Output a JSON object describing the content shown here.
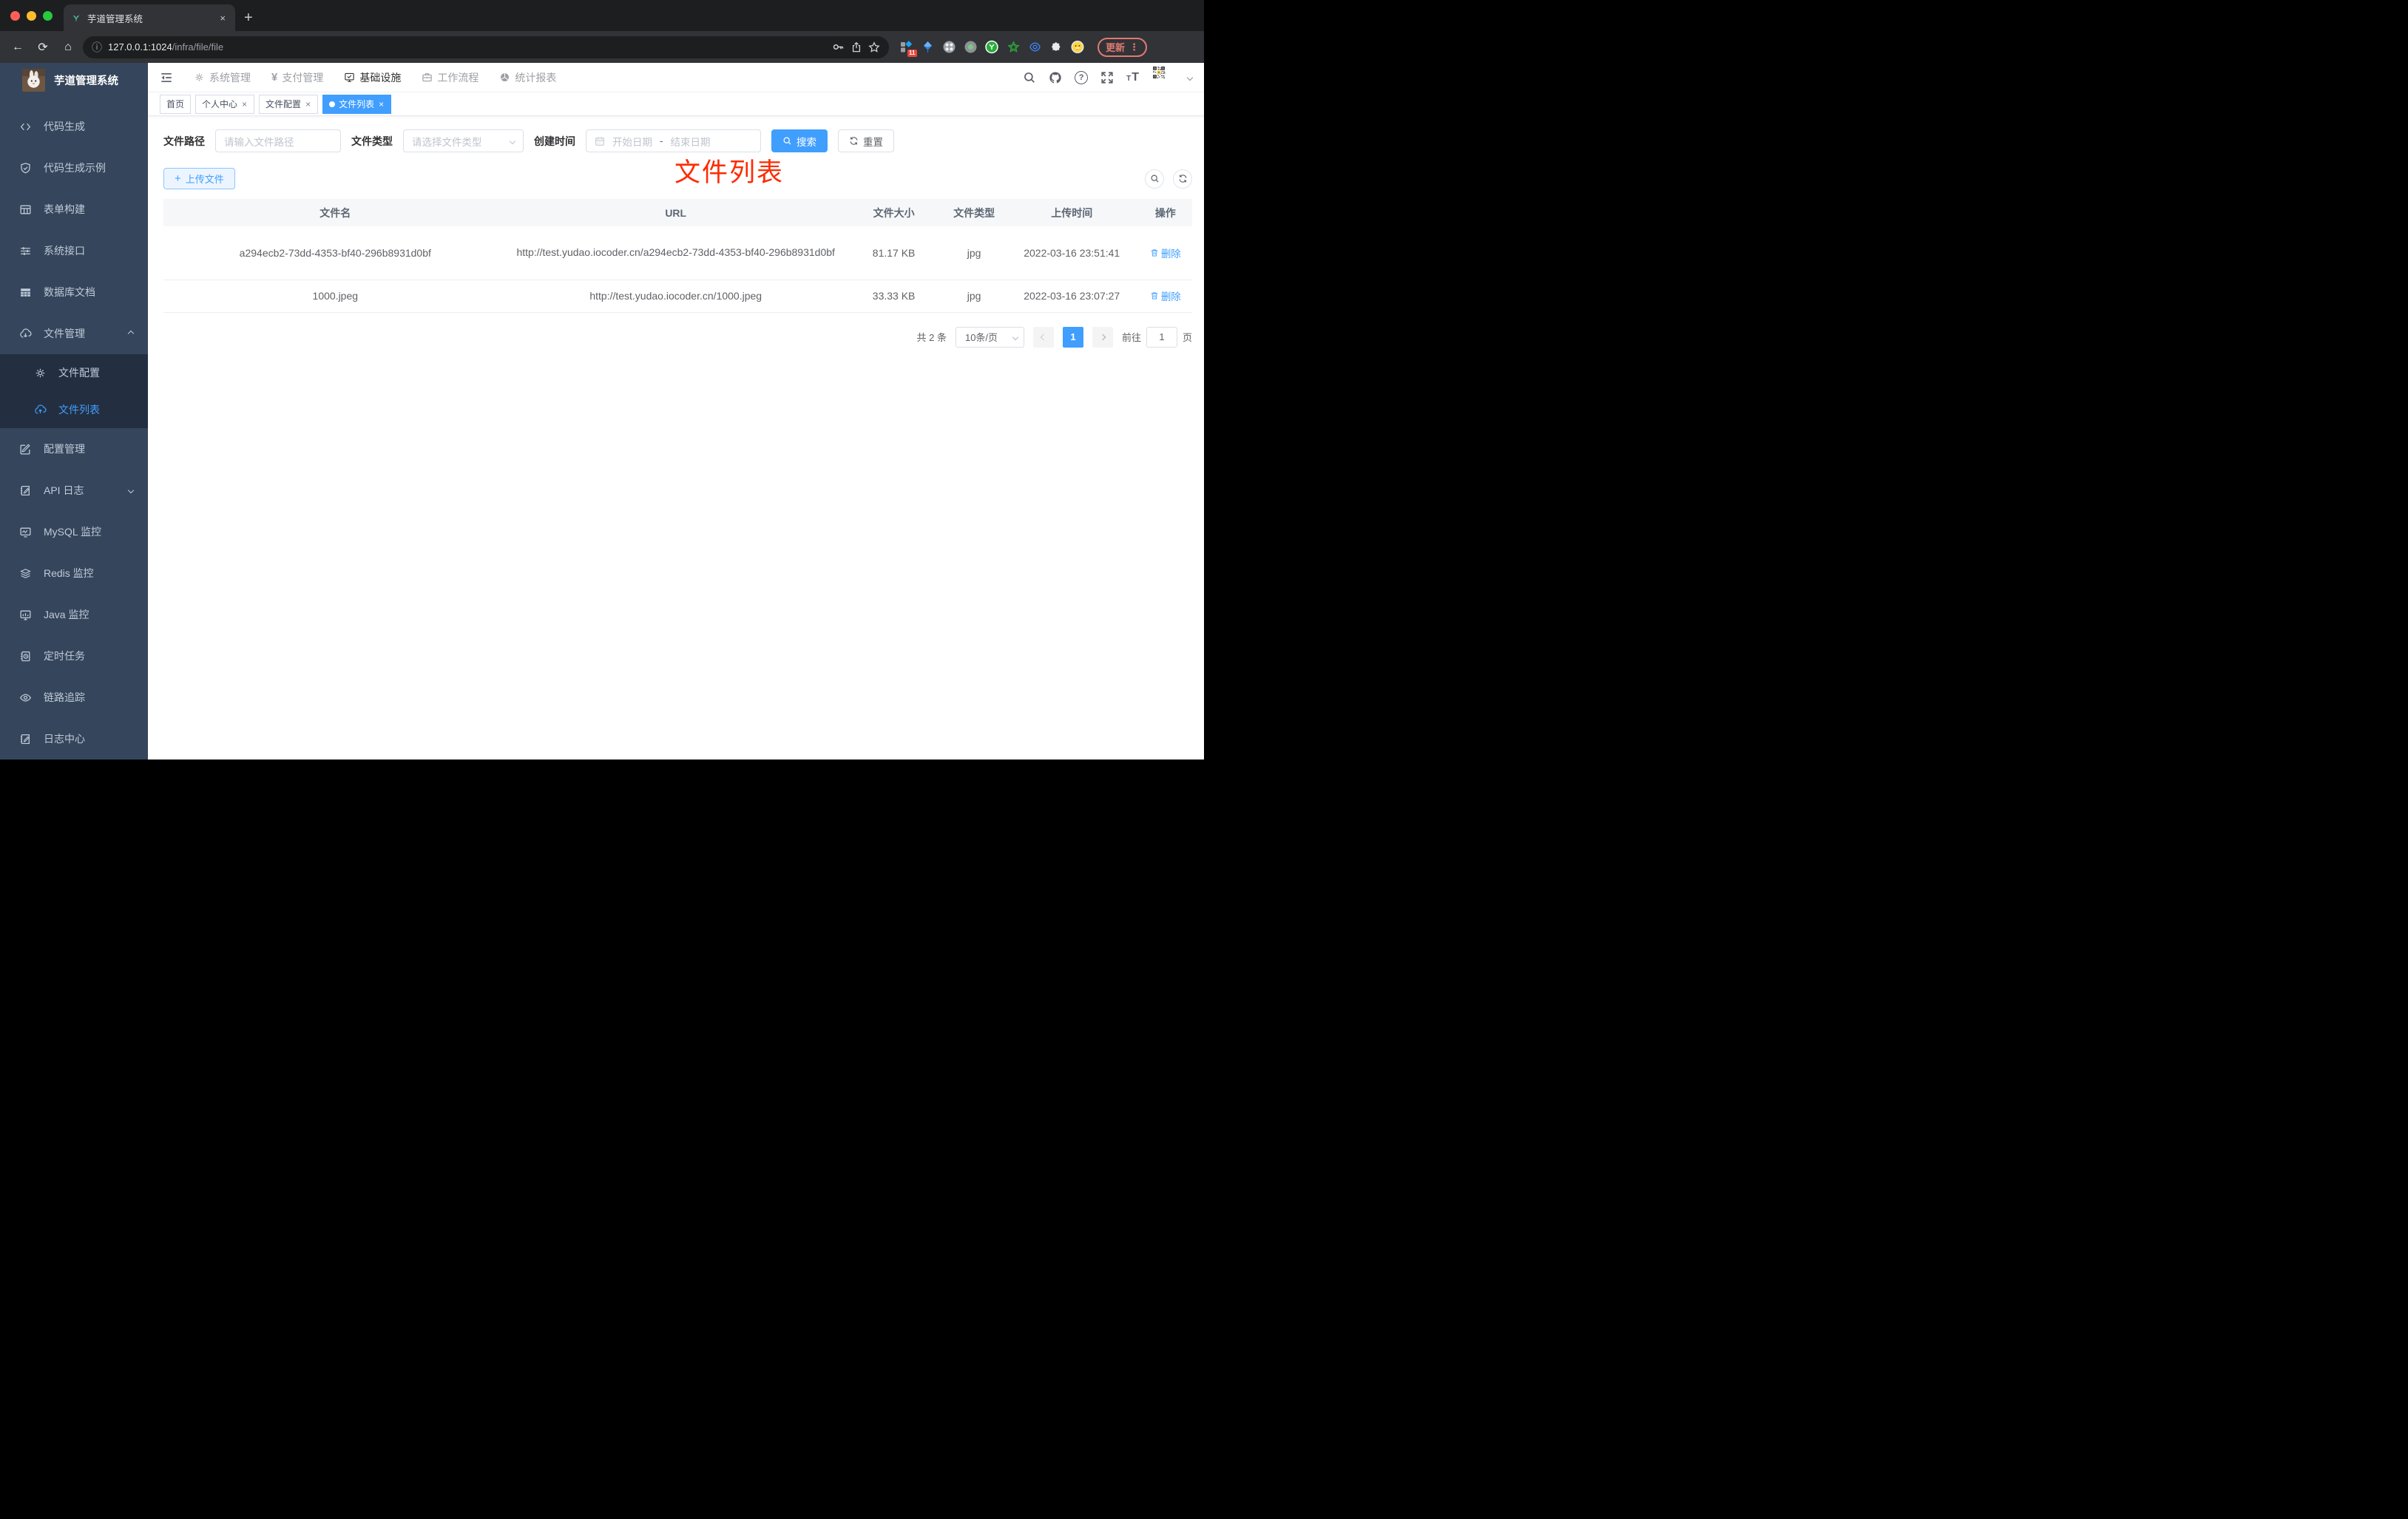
{
  "browser": {
    "tab_title": "芋道管理系统",
    "new_tab": "+",
    "close": "×",
    "url_host": "127.0.0.1:1024",
    "url_path": "/infra/file/file",
    "update_label": "更新",
    "ext_badge": "11",
    "kebab": "⋮"
  },
  "sidebar": {
    "title": "芋道管理系统",
    "items": [
      {
        "label": "代码生成"
      },
      {
        "label": "代码生成示例"
      },
      {
        "label": "表单构建"
      },
      {
        "label": "系统接口"
      },
      {
        "label": "数据库文档"
      },
      {
        "label": "文件管理"
      },
      {
        "label": "文件配置"
      },
      {
        "label": "文件列表"
      },
      {
        "label": "配置管理"
      },
      {
        "label": "API 日志"
      },
      {
        "label": "MySQL 监控"
      },
      {
        "label": "Redis 监控"
      },
      {
        "label": "Java 监控"
      },
      {
        "label": "定时任务"
      },
      {
        "label": "链路追踪"
      },
      {
        "label": "日志中心"
      }
    ]
  },
  "navbar": {
    "menus": [
      {
        "label": "系统管理"
      },
      {
        "label": "支付管理"
      },
      {
        "label": "基础设施"
      },
      {
        "label": "工作流程"
      },
      {
        "label": "统计报表"
      }
    ]
  },
  "tags": [
    {
      "label": "首页"
    },
    {
      "label": "个人中心"
    },
    {
      "label": "文件配置"
    },
    {
      "label": "文件列表"
    }
  ],
  "annotation": "文件列表",
  "filters": {
    "path_label": "文件路径",
    "path_placeholder": "请输入文件路径",
    "type_label": "文件类型",
    "type_placeholder": "请选择文件类型",
    "date_label": "创建时间",
    "date_start_placeholder": "开始日期",
    "date_separator": "-",
    "date_end_placeholder": "结束日期",
    "search_label": "搜索",
    "reset_label": "重置"
  },
  "toolbar": {
    "upload_label": "上传文件",
    "plus": "+"
  },
  "table": {
    "headers": [
      "文件名",
      "URL",
      "文件大小",
      "文件类型",
      "上传时间",
      "操作"
    ],
    "rows": [
      {
        "name": "a294ecb2-73dd-4353-bf40-296b8931d0bf",
        "url": "http://test.yudao.iocoder.cn/a294ecb2-73dd-4353-bf40-296b8931d0bf",
        "size": "81.17 KB",
        "type": "jpg",
        "time": "2022-03-16 23:51:41",
        "action": "删除"
      },
      {
        "name": "1000.jpeg",
        "url": "http://test.yudao.iocoder.cn/1000.jpeg",
        "size": "33.33 KB",
        "type": "jpg",
        "time": "2022-03-16 23:07:27",
        "action": "删除"
      }
    ]
  },
  "pagination": {
    "total": "共 2 条",
    "page_size": "10条/页",
    "current": "1",
    "goto_label": "前往",
    "goto_value": "1",
    "page_label": "页"
  },
  "colors": {
    "accent": "#409eff",
    "annotation_red": "#fe2b00",
    "sidebar_bg": "#35455b",
    "submenu_bg": "#232f41"
  }
}
